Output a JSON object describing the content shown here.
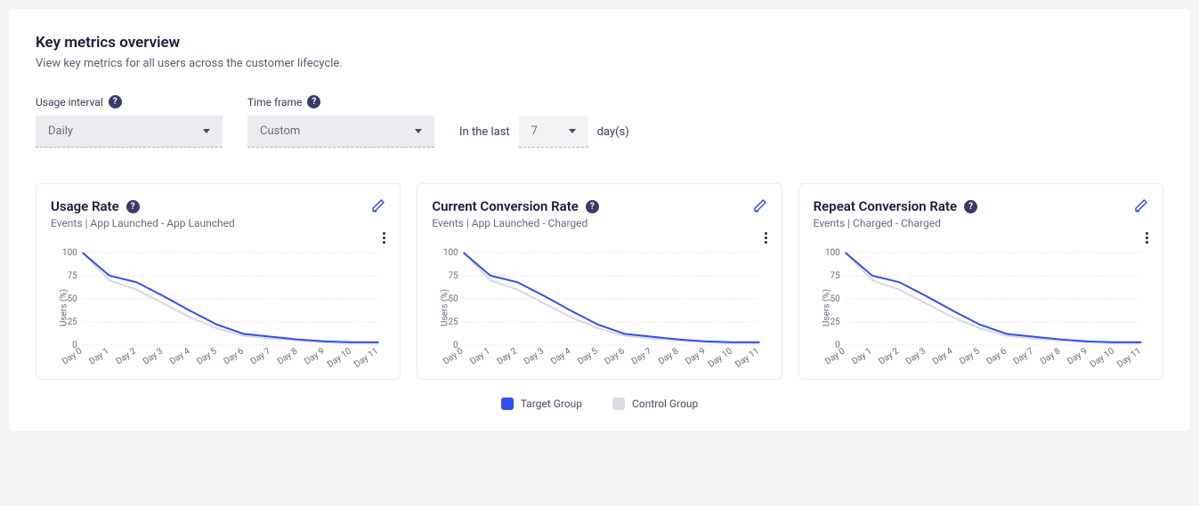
{
  "header": {
    "title": "Key metrics overview",
    "subtitle": "View key metrics for all users across the customer lifecycle."
  },
  "controls": {
    "usage_interval_label": "Usage interval",
    "usage_interval_value": "Daily",
    "timeframe_label": "Time frame",
    "timeframe_value": "Custom",
    "in_the_last_prefix": "In the last",
    "days_value": "7",
    "days_suffix": "day(s)",
    "help_glyph": "?"
  },
  "legend": {
    "target": "Target Group",
    "control": "Control Group"
  },
  "cards": [
    {
      "title": "Usage Rate",
      "subtitle": "Events | App Launched - App Launched",
      "yaxis": "Users (%)"
    },
    {
      "title": "Current Conversion Rate",
      "subtitle": "Events | App Launched - Charged",
      "yaxis": "Users (%)"
    },
    {
      "title": "Repeat Conversion Rate",
      "subtitle": "Events | Charged - Charged",
      "yaxis": "Users (%)"
    }
  ],
  "chart_data": [
    {
      "type": "line",
      "title": "Usage Rate",
      "xlabel": "",
      "ylabel": "Users (%)",
      "ylim": [
        0,
        100
      ],
      "yticks": [
        0,
        25,
        50,
        75,
        100
      ],
      "categories": [
        "Day 0",
        "Day 1",
        "Day 2",
        "Day 3",
        "Day 4",
        "Day 5",
        "Day 6",
        "Day 7",
        "Day 8",
        "Day 9",
        "Day 10",
        "Day 11"
      ],
      "series": [
        {
          "name": "Target Group",
          "values": [
            100,
            75,
            68,
            53,
            37,
            22,
            12,
            9,
            6,
            4,
            3,
            3
          ]
        },
        {
          "name": "Control Group",
          "values": [
            100,
            70,
            60,
            45,
            30,
            18,
            10,
            7,
            5,
            3,
            2,
            2
          ]
        }
      ]
    },
    {
      "type": "line",
      "title": "Current Conversion Rate",
      "xlabel": "",
      "ylabel": "Users (%)",
      "ylim": [
        0,
        100
      ],
      "yticks": [
        0,
        25,
        50,
        75,
        100
      ],
      "categories": [
        "Day 0",
        "Day 1",
        "Day 2",
        "Day 3",
        "Day 4",
        "Day 5",
        "Day 6",
        "Day 7",
        "Day 8",
        "Day 9",
        "Day 10",
        "Day 11"
      ],
      "series": [
        {
          "name": "Target Group",
          "values": [
            100,
            75,
            68,
            53,
            37,
            22,
            12,
            9,
            6,
            4,
            3,
            3
          ]
        },
        {
          "name": "Control Group",
          "values": [
            100,
            70,
            60,
            45,
            30,
            18,
            10,
            7,
            5,
            3,
            2,
            2
          ]
        }
      ]
    },
    {
      "type": "line",
      "title": "Repeat Conversion Rate",
      "xlabel": "",
      "ylabel": "Users (%)",
      "ylim": [
        0,
        100
      ],
      "yticks": [
        0,
        25,
        50,
        75,
        100
      ],
      "categories": [
        "Day 0",
        "Day 1",
        "Day 2",
        "Day 3",
        "Day 4",
        "Day 5",
        "Day 6",
        "Day 7",
        "Day 8",
        "Day 9",
        "Day 10",
        "Day 11"
      ],
      "series": [
        {
          "name": "Target Group",
          "values": [
            100,
            75,
            68,
            53,
            37,
            22,
            12,
            9,
            6,
            4,
            3,
            3
          ]
        },
        {
          "name": "Control Group",
          "values": [
            100,
            70,
            60,
            45,
            30,
            18,
            10,
            7,
            5,
            3,
            2,
            2
          ]
        }
      ]
    }
  ]
}
